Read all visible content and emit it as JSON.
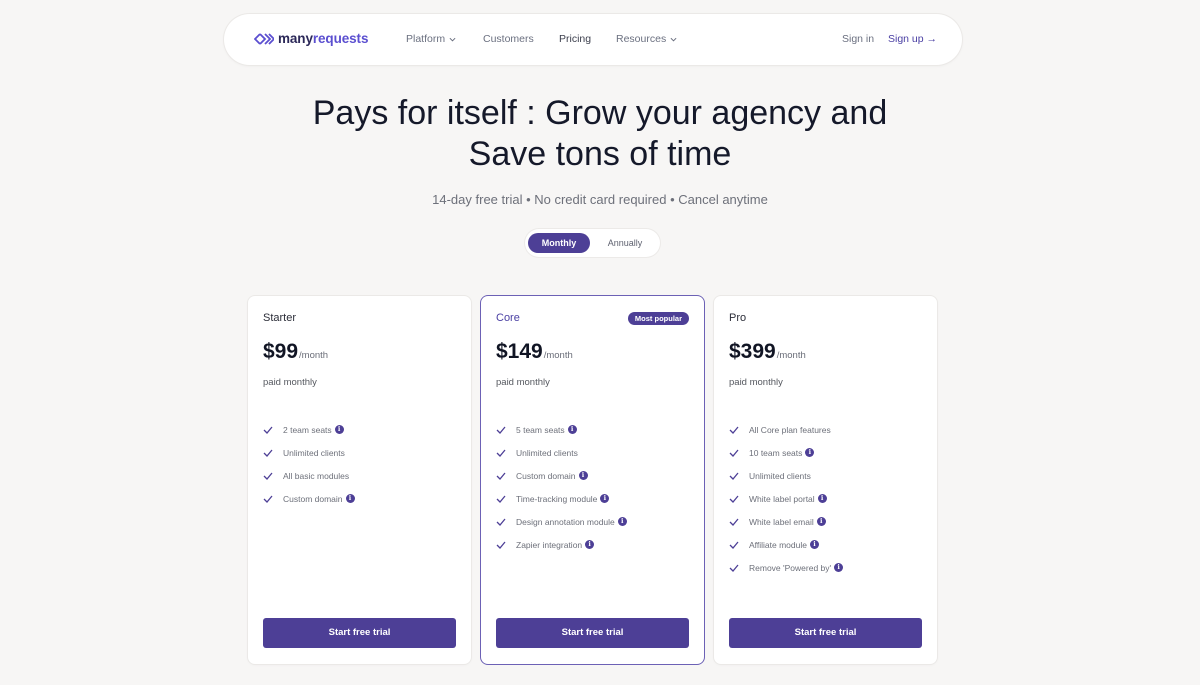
{
  "brand": {
    "name_part1": "many",
    "name_part2": "requests",
    "accent": "#4d3f96"
  },
  "nav": {
    "links": [
      {
        "label": "Platform",
        "has_dropdown": true
      },
      {
        "label": "Customers",
        "has_dropdown": false
      },
      {
        "label": "Pricing",
        "has_dropdown": false,
        "active": true
      },
      {
        "label": "Resources",
        "has_dropdown": true
      }
    ],
    "sign_in": "Sign in",
    "sign_up": "Sign up →"
  },
  "hero": {
    "title_line1": "Pays for itself : Grow your agency and",
    "title_line2": "Save tons of time",
    "subtitle": "14-day free trial • No credit card required • Cancel anytime"
  },
  "billing_toggle": {
    "options": [
      "Monthly",
      "Annually"
    ],
    "selected": "Monthly"
  },
  "plans": [
    {
      "name": "Starter",
      "price": "$99",
      "period": "/month",
      "billing": "paid monthly",
      "badge": null,
      "features": [
        {
          "text": "2 team seats",
          "info": true
        },
        {
          "text": "Unlimited clients",
          "info": false
        },
        {
          "text": "All basic modules",
          "info": false
        },
        {
          "text": "Custom domain",
          "info": true
        }
      ],
      "cta": "Start free trial"
    },
    {
      "name": "Core",
      "price": "$149",
      "period": "/month",
      "billing": "paid monthly",
      "badge": "Most popular",
      "features": [
        {
          "text": "5 team seats",
          "info": true
        },
        {
          "text": "Unlimited clients",
          "info": false
        },
        {
          "text": "Custom domain",
          "info": true
        },
        {
          "text": "Time-tracking module",
          "info": true
        },
        {
          "text": "Design annotation module",
          "info": true
        },
        {
          "text": "Zapier integration",
          "info": true
        }
      ],
      "cta": "Start free trial"
    },
    {
      "name": "Pro",
      "price": "$399",
      "period": "/month",
      "billing": "paid monthly",
      "badge": null,
      "features": [
        {
          "text": "All Core plan features",
          "info": false
        },
        {
          "text": "10 team seats",
          "info": true
        },
        {
          "text": "Unlimited clients",
          "info": false
        },
        {
          "text": "White label portal",
          "info": true
        },
        {
          "text": "White label email",
          "info": true
        },
        {
          "text": "Affiliate module",
          "info": true
        },
        {
          "text": "Remove 'Powered by'",
          "info": true
        }
      ],
      "cta": "Start free trial"
    }
  ],
  "icons": {
    "check": "check-icon",
    "info": "info-icon",
    "chevron": "chevron-down-icon",
    "logo": "logo-chevrons-icon"
  }
}
